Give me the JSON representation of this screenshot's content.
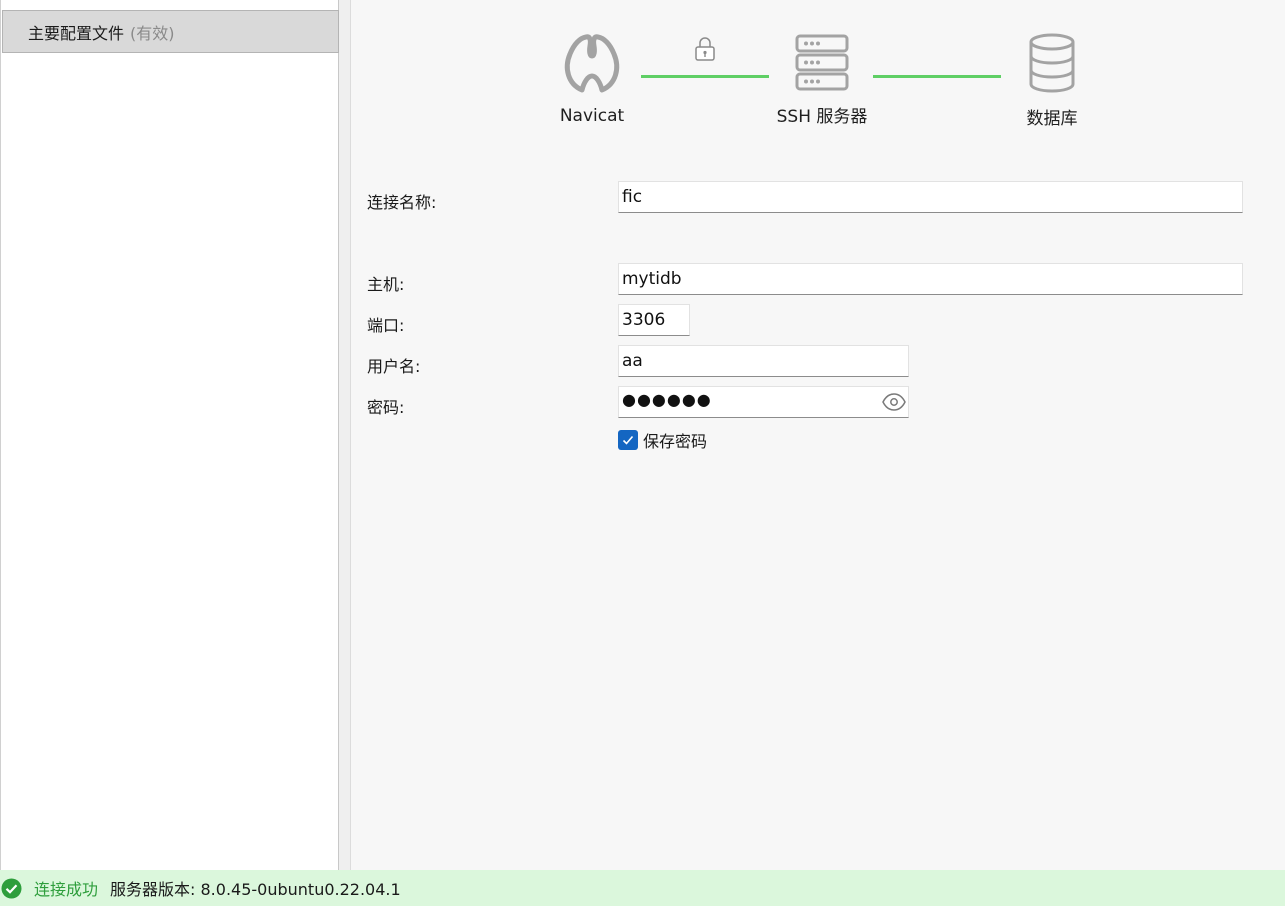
{
  "sidebar": {
    "profile": {
      "name": "主要配置文件",
      "status": "(有效)"
    }
  },
  "diagram": {
    "nodes": [
      {
        "label": "Navicat",
        "icon": "navicat-logo-icon"
      },
      {
        "label": "SSH 服务器",
        "icon": "server-icon"
      },
      {
        "label": "数据库",
        "icon": "database-icon"
      }
    ],
    "link_color": "#5fcf65",
    "tunnel_icon": "lock-icon"
  },
  "form": {
    "connection_name": {
      "label": "连接名称:",
      "value": "fic"
    },
    "host": {
      "label": "主机:",
      "value": "mytidb"
    },
    "port": {
      "label": "端口:",
      "value": "3306"
    },
    "username": {
      "label": "用户名:",
      "value": "aa"
    },
    "password": {
      "label": "密码:",
      "masked_value": "●●●●●●",
      "reveal_icon": "eye-icon"
    },
    "save_password": {
      "label": "保存密码",
      "checked": true
    }
  },
  "status_bar": {
    "icon": "check-circle-icon",
    "message": "连接成功",
    "server_version": "服务器版本: 8.0.45-0ubuntu0.22.04.1",
    "accent": "#2e9e3c",
    "background": "#dbf7dc"
  }
}
